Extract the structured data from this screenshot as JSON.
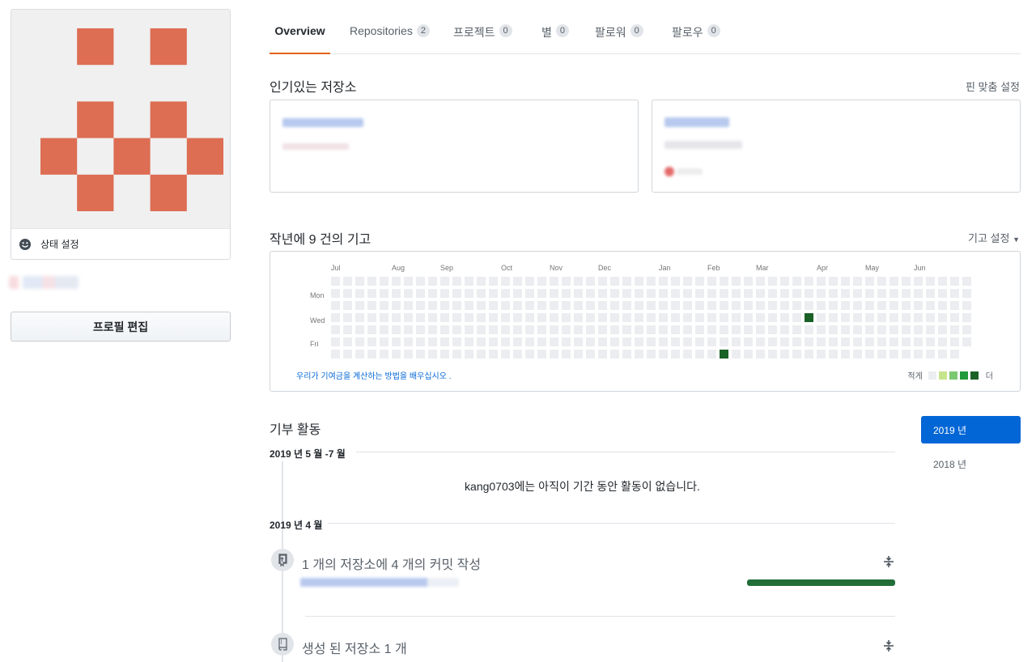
{
  "profile": {
    "status_label": "상태 설정",
    "edit_button": "프로필 편집"
  },
  "tabs": [
    {
      "label": "Overview",
      "count": null,
      "active": true
    },
    {
      "label": "Repositories",
      "count": "2",
      "active": false
    },
    {
      "label": "프로젝트",
      "count": "0",
      "active": false
    },
    {
      "label": "별",
      "count": "0",
      "active": false
    },
    {
      "label": "팔로워",
      "count": "0",
      "active": false
    },
    {
      "label": "팔로우",
      "count": "0",
      "active": false
    }
  ],
  "pinned": {
    "title": "인기있는 저장소",
    "customize": "핀 맞춤 설정"
  },
  "contributions": {
    "title": "작년에 9 건의 기고",
    "settings": "기고 설정",
    "months": [
      "Jul",
      "Aug",
      "Sep",
      "Oct",
      "Nov",
      "Dec",
      "Jan",
      "Feb",
      "Mar",
      "Apr",
      "May",
      "Jun"
    ],
    "days": [
      "Mon",
      "Wed",
      "Fri"
    ],
    "learn_link": "우리가 기여금을 계산하는 방법을 배우십시오 .",
    "legend_less": "적게",
    "legend_more": "더",
    "colors": {
      "empty": "#ebedf0",
      "l1": "#c6e48b",
      "l2": "#7bc96f",
      "l3": "#239a3b",
      "l4": "#196127"
    },
    "contribution_days": [
      {
        "week": 39,
        "day": 3,
        "level": 4
      },
      {
        "week": 32,
        "day": 6,
        "level": 4
      }
    ]
  },
  "activity": {
    "title": "기부 활동",
    "periods": [
      {
        "label": "2019 년 5 월 -7 월",
        "empty_message": "kang0703에는 아직이 기간 동안 활동이 없습니다."
      },
      {
        "label": "2019 년 4 월"
      }
    ],
    "commits_title": "1 개의 저장소에 4 개의 커밋 작성",
    "created_title": "생성 된 저장소 1 개",
    "commit_bar_fraction": 1.0
  },
  "years": [
    {
      "label": "2019 년",
      "active": true
    },
    {
      "label": "2018 년",
      "active": false
    }
  ]
}
